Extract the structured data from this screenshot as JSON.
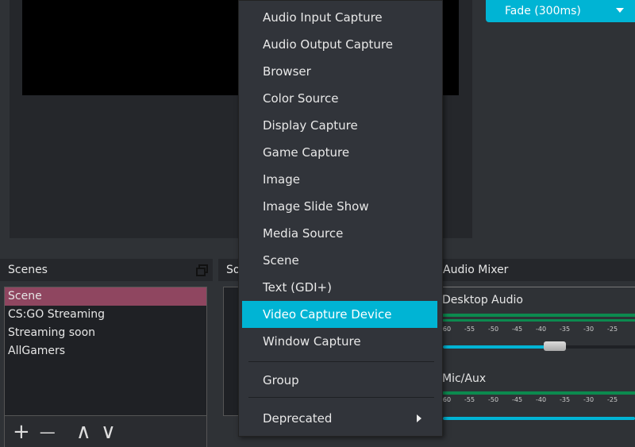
{
  "transition": {
    "selected": "Fade (300ms)"
  },
  "docks": {
    "scenes": "Scenes",
    "sources": "So",
    "mixer": "Audio Mixer"
  },
  "scenes": [
    "Scene",
    "CS:GO Streaming",
    "Streaming soon",
    "AllGamers"
  ],
  "scenes_toolbar": {
    "add": "+",
    "remove": "—",
    "up": "∧",
    "down": "∨"
  },
  "mixer": {
    "channels": [
      {
        "name": "Desktop Audio",
        "volume_fraction": 0.58
      },
      {
        "name": "Mic/Aux",
        "volume_fraction": 1.0
      }
    ],
    "ticks": [
      "-60",
      "-55",
      "-50",
      "-45",
      "-40",
      "-35",
      "-30",
      "-25"
    ]
  },
  "menu": {
    "items": [
      "Audio Input Capture",
      "Audio Output Capture",
      "Browser",
      "Color Source",
      "Display Capture",
      "Game Capture",
      "Image",
      "Image Slide Show",
      "Media Source",
      "Scene",
      "Text (GDI+)",
      "Video Capture Device",
      "Window Capture"
    ],
    "highlighted": "Video Capture Device",
    "group": "Group",
    "deprecated": "Deprecated"
  },
  "colors": {
    "accent": "#00b4d4",
    "selected_scene": "#8f4660"
  }
}
